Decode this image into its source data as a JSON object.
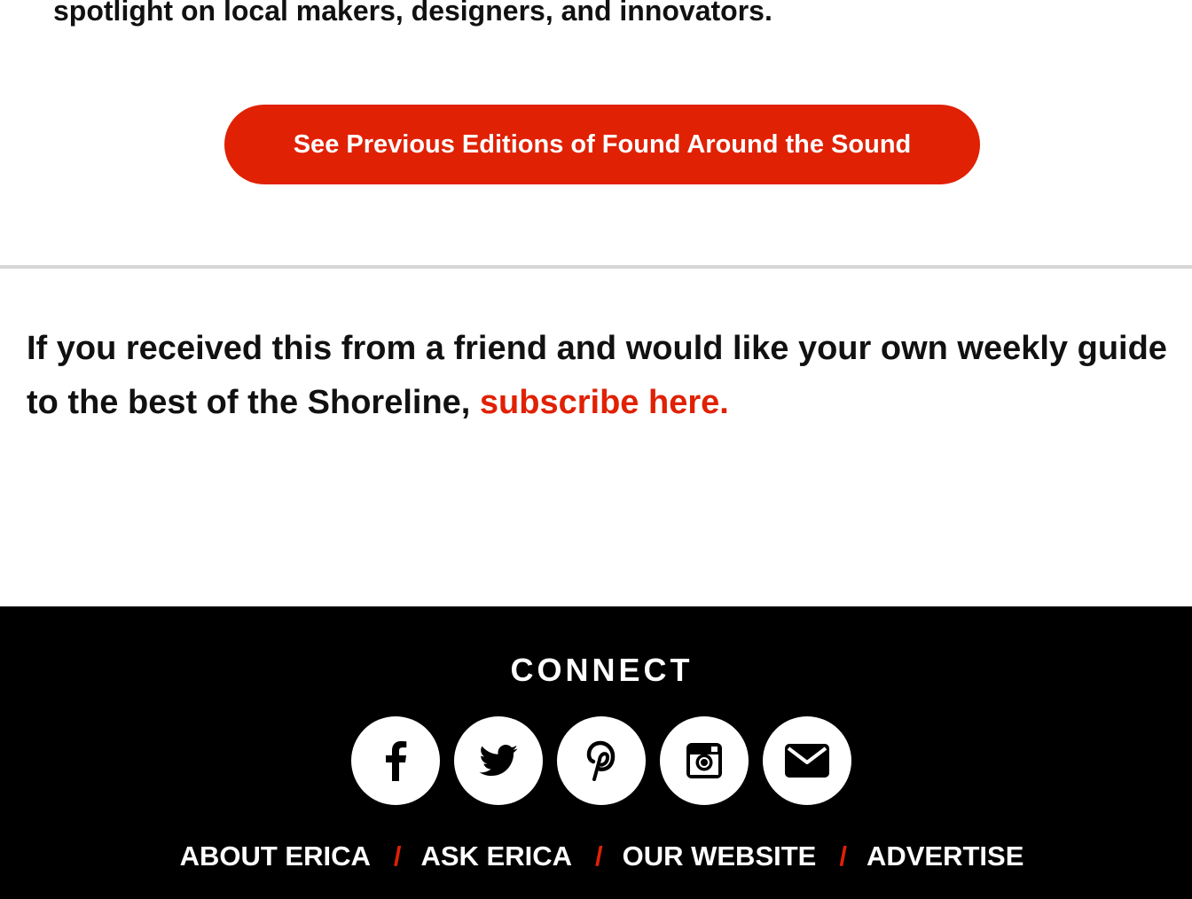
{
  "intro": {
    "text": "spotlight on local makers, designers, and innovators."
  },
  "cta": {
    "label": "See Previous Editions of Found Around the Sound"
  },
  "subscribe": {
    "text": "If you received this from a friend and would like your own weekly guide to the best of the Shoreline, ",
    "link_label": "subscribe here."
  },
  "footer": {
    "connect_heading": "CONNECT",
    "social": [
      {
        "name": "facebook",
        "icon": "facebook-icon"
      },
      {
        "name": "twitter",
        "icon": "twitter-icon"
      },
      {
        "name": "pinterest",
        "icon": "pinterest-icon"
      },
      {
        "name": "instagram",
        "icon": "instagram-icon"
      },
      {
        "name": "email",
        "icon": "envelope-icon"
      }
    ],
    "nav": [
      "ABOUT ERICA",
      "ASK ERICA",
      "OUR WEBSITE",
      "ADVERTISE"
    ],
    "separator": "/"
  },
  "colors": {
    "accent": "#e02104",
    "footer_bg": "#000000",
    "divider": "#d6d6d6"
  }
}
